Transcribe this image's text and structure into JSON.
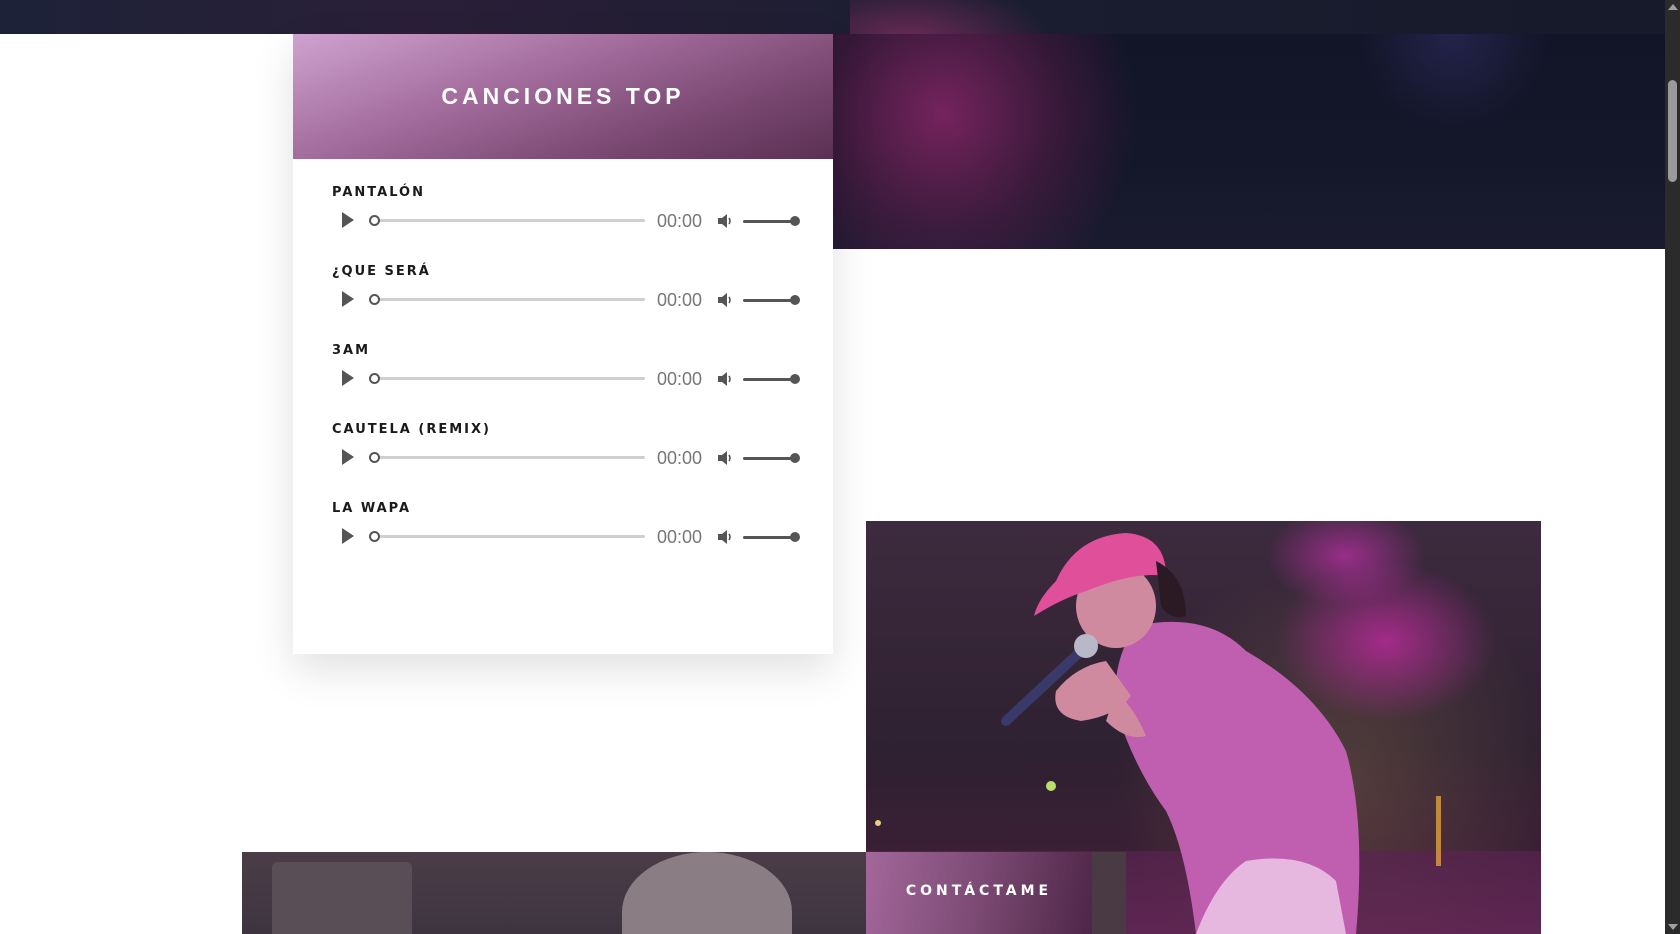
{
  "songs_section": {
    "title": "CANCIONES TOP",
    "songs": [
      {
        "title": "PANTALÓN",
        "time": "00:00"
      },
      {
        "title": "¿QUE SERÁ",
        "time": "00:00"
      },
      {
        "title": "3AM",
        "time": "00:00"
      },
      {
        "title": "CAUTELA (REMIX)",
        "time": "00:00"
      },
      {
        "title": "LA WAPA",
        "time": "00:00"
      }
    ]
  },
  "contact": {
    "label": "CONTÁCTAME"
  },
  "icons": {
    "play": "play-icon",
    "volume": "volume-icon"
  },
  "colors": {
    "header_gradient_start": "#cfa2cf",
    "header_gradient_end": "#5b2f54",
    "hero_dark": "#141729"
  }
}
